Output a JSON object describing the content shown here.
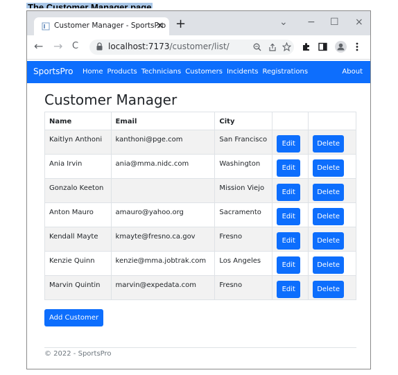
{
  "caption": "The Customer Manager page",
  "browser": {
    "tab_title": "Customer Manager - SportsPro",
    "tab_close": "×",
    "new_tab": "+",
    "controls": {
      "dropdown": "⌄",
      "minimize": "−",
      "maximize": "☐",
      "close": "×"
    },
    "nav": {
      "back": "←",
      "forward": "→",
      "reload": "C"
    },
    "url_host": "localhost:7173",
    "url_path": "/customer/list/"
  },
  "navbar": {
    "brand": "SportsPro",
    "links": [
      "Home",
      "Products",
      "Technicians",
      "Customers",
      "Incidents",
      "Registrations"
    ],
    "about": "About"
  },
  "page": {
    "title": "Customer Manager",
    "columns": [
      "Name",
      "Email",
      "City",
      "",
      ""
    ],
    "rows": [
      {
        "name": "Kaitlyn Anthoni",
        "email": "kanthoni@pge.com",
        "city": "San Francisco"
      },
      {
        "name": "Ania Irvin",
        "email": "ania@mma.nidc.com",
        "city": "Washington"
      },
      {
        "name": "Gonzalo Keeton",
        "email": "",
        "city": "Mission Viejo"
      },
      {
        "name": "Anton Mauro",
        "email": "amauro@yahoo.org",
        "city": "Sacramento"
      },
      {
        "name": "Kendall Mayte",
        "email": "kmayte@fresno.ca.gov",
        "city": "Fresno"
      },
      {
        "name": "Kenzie Quinn",
        "email": "kenzie@mma.jobtrak.com",
        "city": "Los Angeles"
      },
      {
        "name": "Marvin Quintin",
        "email": "marvin@expedata.com",
        "city": "Fresno"
      }
    ],
    "edit_label": "Edit",
    "delete_label": "Delete",
    "add_label": "Add Customer"
  },
  "footer": "© 2022 - SportsPro",
  "colors": {
    "brand_blue": "#0d6efd",
    "stripe": "#f2f2f2"
  }
}
